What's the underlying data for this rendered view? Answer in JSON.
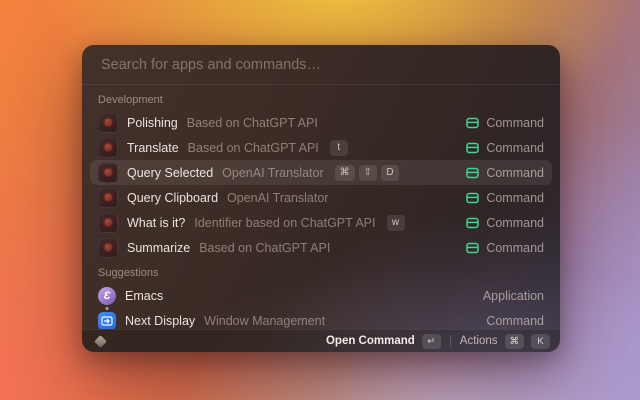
{
  "search": {
    "placeholder": "Search for apps and commands…"
  },
  "sections": {
    "development": {
      "title": "Development",
      "items": [
        {
          "title": "Polishing",
          "subtitle": "Based on ChatGPT API",
          "type": "Command",
          "icon": "openai-translator-icon"
        },
        {
          "title": "Translate",
          "subtitle": "Based on ChatGPT API",
          "type": "Command",
          "icon": "openai-translator-icon",
          "keys": [
            "t"
          ]
        },
        {
          "title": "Query Selected",
          "subtitle": "OpenAI Translator",
          "type": "Command",
          "icon": "openai-translator-icon",
          "keys": [
            "⌘",
            "⇧",
            "D"
          ],
          "selected": true
        },
        {
          "title": "Query Clipboard",
          "subtitle": "OpenAI Translator",
          "type": "Command",
          "icon": "openai-translator-icon"
        },
        {
          "title": "What is it?",
          "subtitle": "Identifier based on ChatGPT API",
          "type": "Command",
          "icon": "openai-translator-icon",
          "keys": [
            "w"
          ]
        },
        {
          "title": "Summarize",
          "subtitle": "Based on ChatGPT API",
          "type": "Command",
          "icon": "openai-translator-icon"
        }
      ]
    },
    "suggestions": {
      "title": "Suggestions",
      "items": [
        {
          "title": "Emacs",
          "type": "Application",
          "icon": "emacs-icon",
          "icon_glyph": "Ɛ",
          "running_indicator": true
        },
        {
          "title": "Next Display",
          "subtitle": "Window Management",
          "type": "Command",
          "icon": "next-display-icon"
        }
      ]
    }
  },
  "footer": {
    "logo_icon": "raycast-logo-icon",
    "primary_label": "Open Command",
    "primary_key": "↵",
    "actions_label": "Actions",
    "actions_keys": [
      "⌘",
      "K"
    ]
  },
  "colors": {
    "accent_green": "#3fd68f",
    "emacs_purple": "#8b5fbf",
    "next_display_blue": "#2f7cf6",
    "panel_brown": "#3a2b25"
  }
}
